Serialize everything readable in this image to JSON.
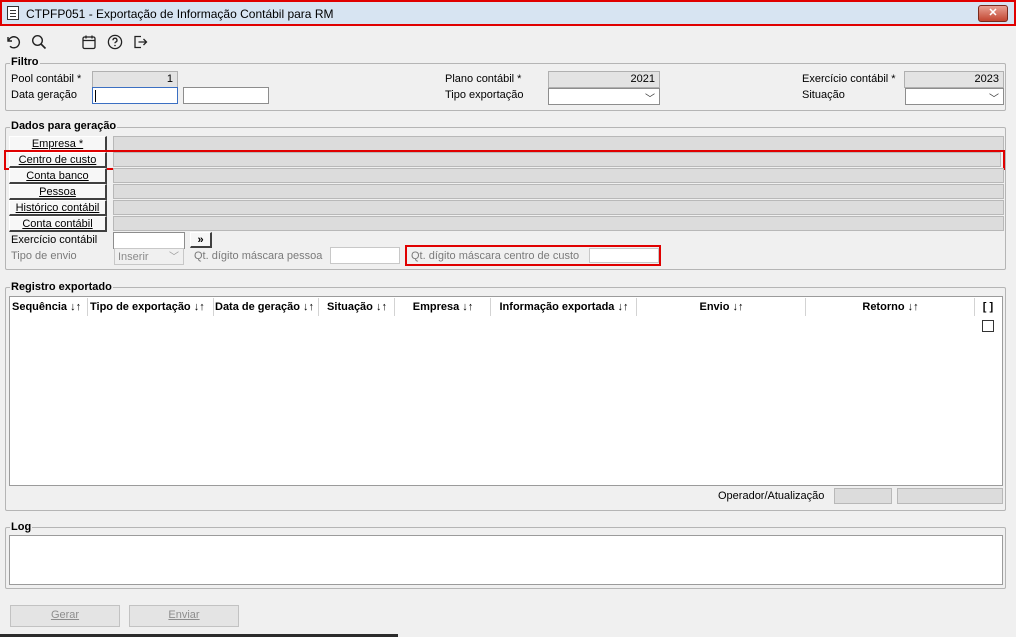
{
  "window": {
    "title": "CTPFP051 - Exportação de Informação Contábil para RM",
    "close_label": "✕"
  },
  "toolbar": {
    "icons": [
      "undo-icon",
      "search-icon",
      "calendar-icon",
      "help-icon",
      "exit-icon"
    ]
  },
  "filtro": {
    "legend": "Filtro",
    "pool_label": "Pool contábil *",
    "pool_value": "1",
    "data_label": "Data geração",
    "data_from": "",
    "data_to": "",
    "plano_label": "Plano contábil *",
    "plano_value": "2021",
    "tipo_label": "Tipo exportação",
    "tipo_value": "",
    "exercicio_label": "Exercício contábil *",
    "exercicio_value": "2023",
    "situacao_label": "Situação",
    "situacao_value": ""
  },
  "dados": {
    "legend": "Dados para geração",
    "lookups": [
      {
        "label": "Empresa *",
        "value": ""
      },
      {
        "label": "Centro de custo",
        "value": ""
      },
      {
        "label": "Conta banco",
        "value": ""
      },
      {
        "label": "Pessoa",
        "value": ""
      },
      {
        "label": "Histórico contábil",
        "value": ""
      },
      {
        "label": "Conta contábil",
        "value": ""
      }
    ],
    "exercicio_label": "Exercício contábil",
    "exercicio_value": "",
    "next_label": "»",
    "tipo_envio_label": "Tipo de envio",
    "tipo_envio_value": "Inserir",
    "mascara_pessoa_label": "Qt. dígito máscara pessoa",
    "mascara_pessoa_value": "",
    "mascara_cc_label": "Qt. dígito máscara centro de custo",
    "mascara_cc_value": ""
  },
  "registro": {
    "legend": "Registro exportado",
    "columns": [
      "Sequência ↓↑",
      "Tipo de exportação ↓↑",
      "Data de geração ↓↑",
      "Situação ↓↑",
      "Empresa ↓↑",
      "Informação exportada ↓↑",
      "Envio ↓↑",
      "Retorno ↓↑",
      "[ ]"
    ],
    "operador_label": "Operador/Atualização",
    "operador_value": "",
    "atualizacao_value": ""
  },
  "log": {
    "legend": "Log",
    "text": ""
  },
  "buttons": {
    "gerar": "Gerar",
    "enviar": "Enviar"
  }
}
